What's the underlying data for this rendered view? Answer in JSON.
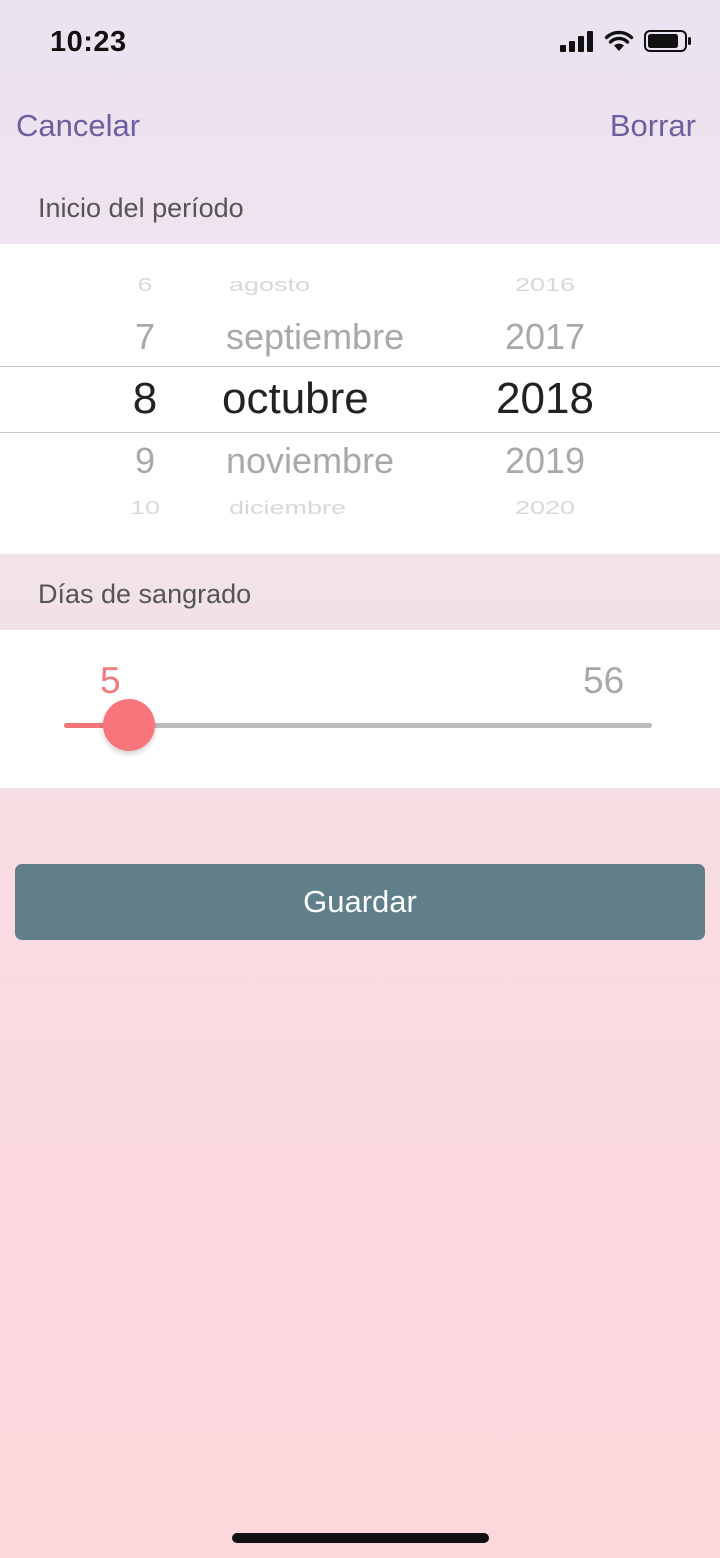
{
  "status_bar": {
    "time": "10:23",
    "icons": [
      "cellular-signal-icon",
      "wifi-icon",
      "battery-icon"
    ]
  },
  "nav": {
    "cancel_label": "Cancelar",
    "clear_label": "Borrar"
  },
  "period_start": {
    "header": "Inicio del período",
    "days": [
      "6",
      "7",
      "8",
      "9",
      "10"
    ],
    "months": [
      "agosto",
      "septiembre",
      "octubre",
      "noviembre",
      "diciembre"
    ],
    "years": [
      "2016",
      "2017",
      "2018",
      "2019",
      "2020"
    ],
    "selected": {
      "day": "8",
      "month": "octubre",
      "year": "2018"
    }
  },
  "bleeding_days": {
    "header": "Días de sangrado",
    "value": "5",
    "max": "56",
    "fraction": 0.11
  },
  "save_label": "Guardar",
  "colors": {
    "accent_purple": "#6c5fa0",
    "slider_red": "#f8767b",
    "button_slate": "#607f8b"
  }
}
